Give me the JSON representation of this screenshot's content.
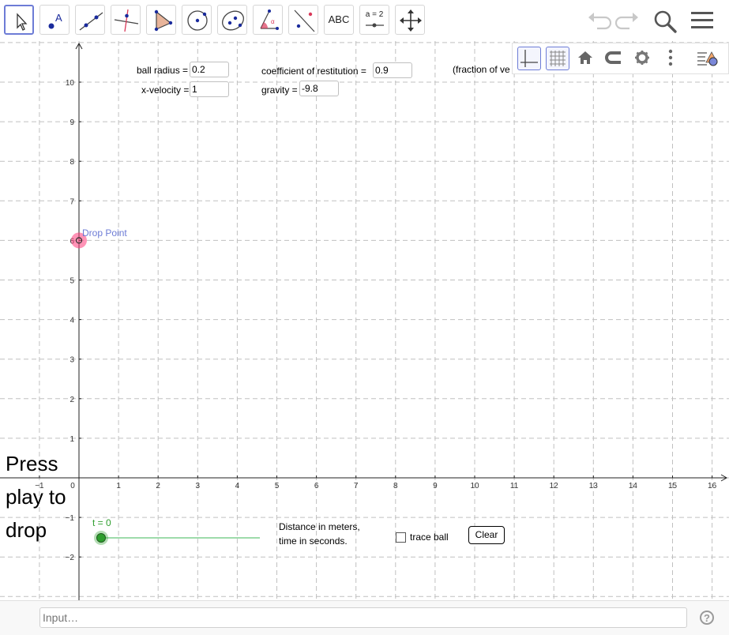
{
  "toolbar": {
    "tools": [
      {
        "name": "move-tool",
        "icon": "arrow-cursor-icon"
      },
      {
        "name": "point-tool",
        "icon": "point-icon",
        "glyph": "A"
      },
      {
        "name": "line-tool",
        "icon": "line-through-points-icon"
      },
      {
        "name": "perpendicular-line-tool",
        "icon": "perpendicular-icon"
      },
      {
        "name": "polygon-tool",
        "icon": "polygon-icon"
      },
      {
        "name": "circle-tool",
        "icon": "circle-center-point-icon"
      },
      {
        "name": "conic-tool",
        "icon": "ellipse-icon"
      },
      {
        "name": "angle-tool",
        "icon": "angle-icon"
      },
      {
        "name": "reflect-tool",
        "icon": "reflect-icon"
      },
      {
        "name": "text-tool",
        "icon": "text-icon",
        "label": "ABC"
      },
      {
        "name": "slider-tool",
        "icon": "slider-icon",
        "label": "a = 2"
      },
      {
        "name": "move-view-tool",
        "icon": "move-graphics-icon"
      }
    ],
    "right_icons": [
      "undo-icon",
      "redo-icon",
      "search-icon",
      "menu-icon"
    ]
  },
  "stylebar": {
    "buttons": [
      "axes-icon",
      "grid-icon",
      "home-icon",
      "magnet-icon",
      "gear-icon",
      "more-vert-icon",
      "algebra-toggle-icon"
    ]
  },
  "params": {
    "ball_radius_label": "ball radius =",
    "ball_radius_value": "0.2",
    "x_velocity_label": "x-velocity =",
    "x_velocity_value": "1",
    "cor_label": "coefficient of restitution =",
    "cor_value": "0.9",
    "gravity_label": "gravity =",
    "gravity_value": "-9.8",
    "fraction_note": "(fraction of ve"
  },
  "graph": {
    "x_ticks": [
      "−1",
      "0",
      "1",
      "2",
      "3",
      "4",
      "5",
      "6",
      "7",
      "8",
      "9",
      "10",
      "11",
      "12",
      "13",
      "14",
      "15",
      "16"
    ],
    "y_ticks": [
      "10",
      "9",
      "8",
      "7",
      "6",
      "5",
      "4",
      "3",
      "2",
      "1",
      "−1",
      "−2"
    ],
    "drop_point_label": "Drop Point",
    "drop_point": {
      "x": 0,
      "y": 6
    },
    "slider_label": "t = 0",
    "slider_value": 0,
    "colors": {
      "drop_point": "#ff3b7a",
      "slider": "#2e9e2e",
      "grid": "#c0c0c0",
      "label_blue": "#6d7cd6"
    }
  },
  "instructions": {
    "press_play": [
      "Press",
      "play to",
      "drop"
    ],
    "units_line1": "Distance in meters,",
    "units_line2": "time in seconds."
  },
  "controls": {
    "trace_label": "trace ball",
    "trace_checked": false,
    "clear_label": "Clear"
  },
  "input_bar": {
    "placeholder": "Input…",
    "help_icon": "help-icon"
  }
}
